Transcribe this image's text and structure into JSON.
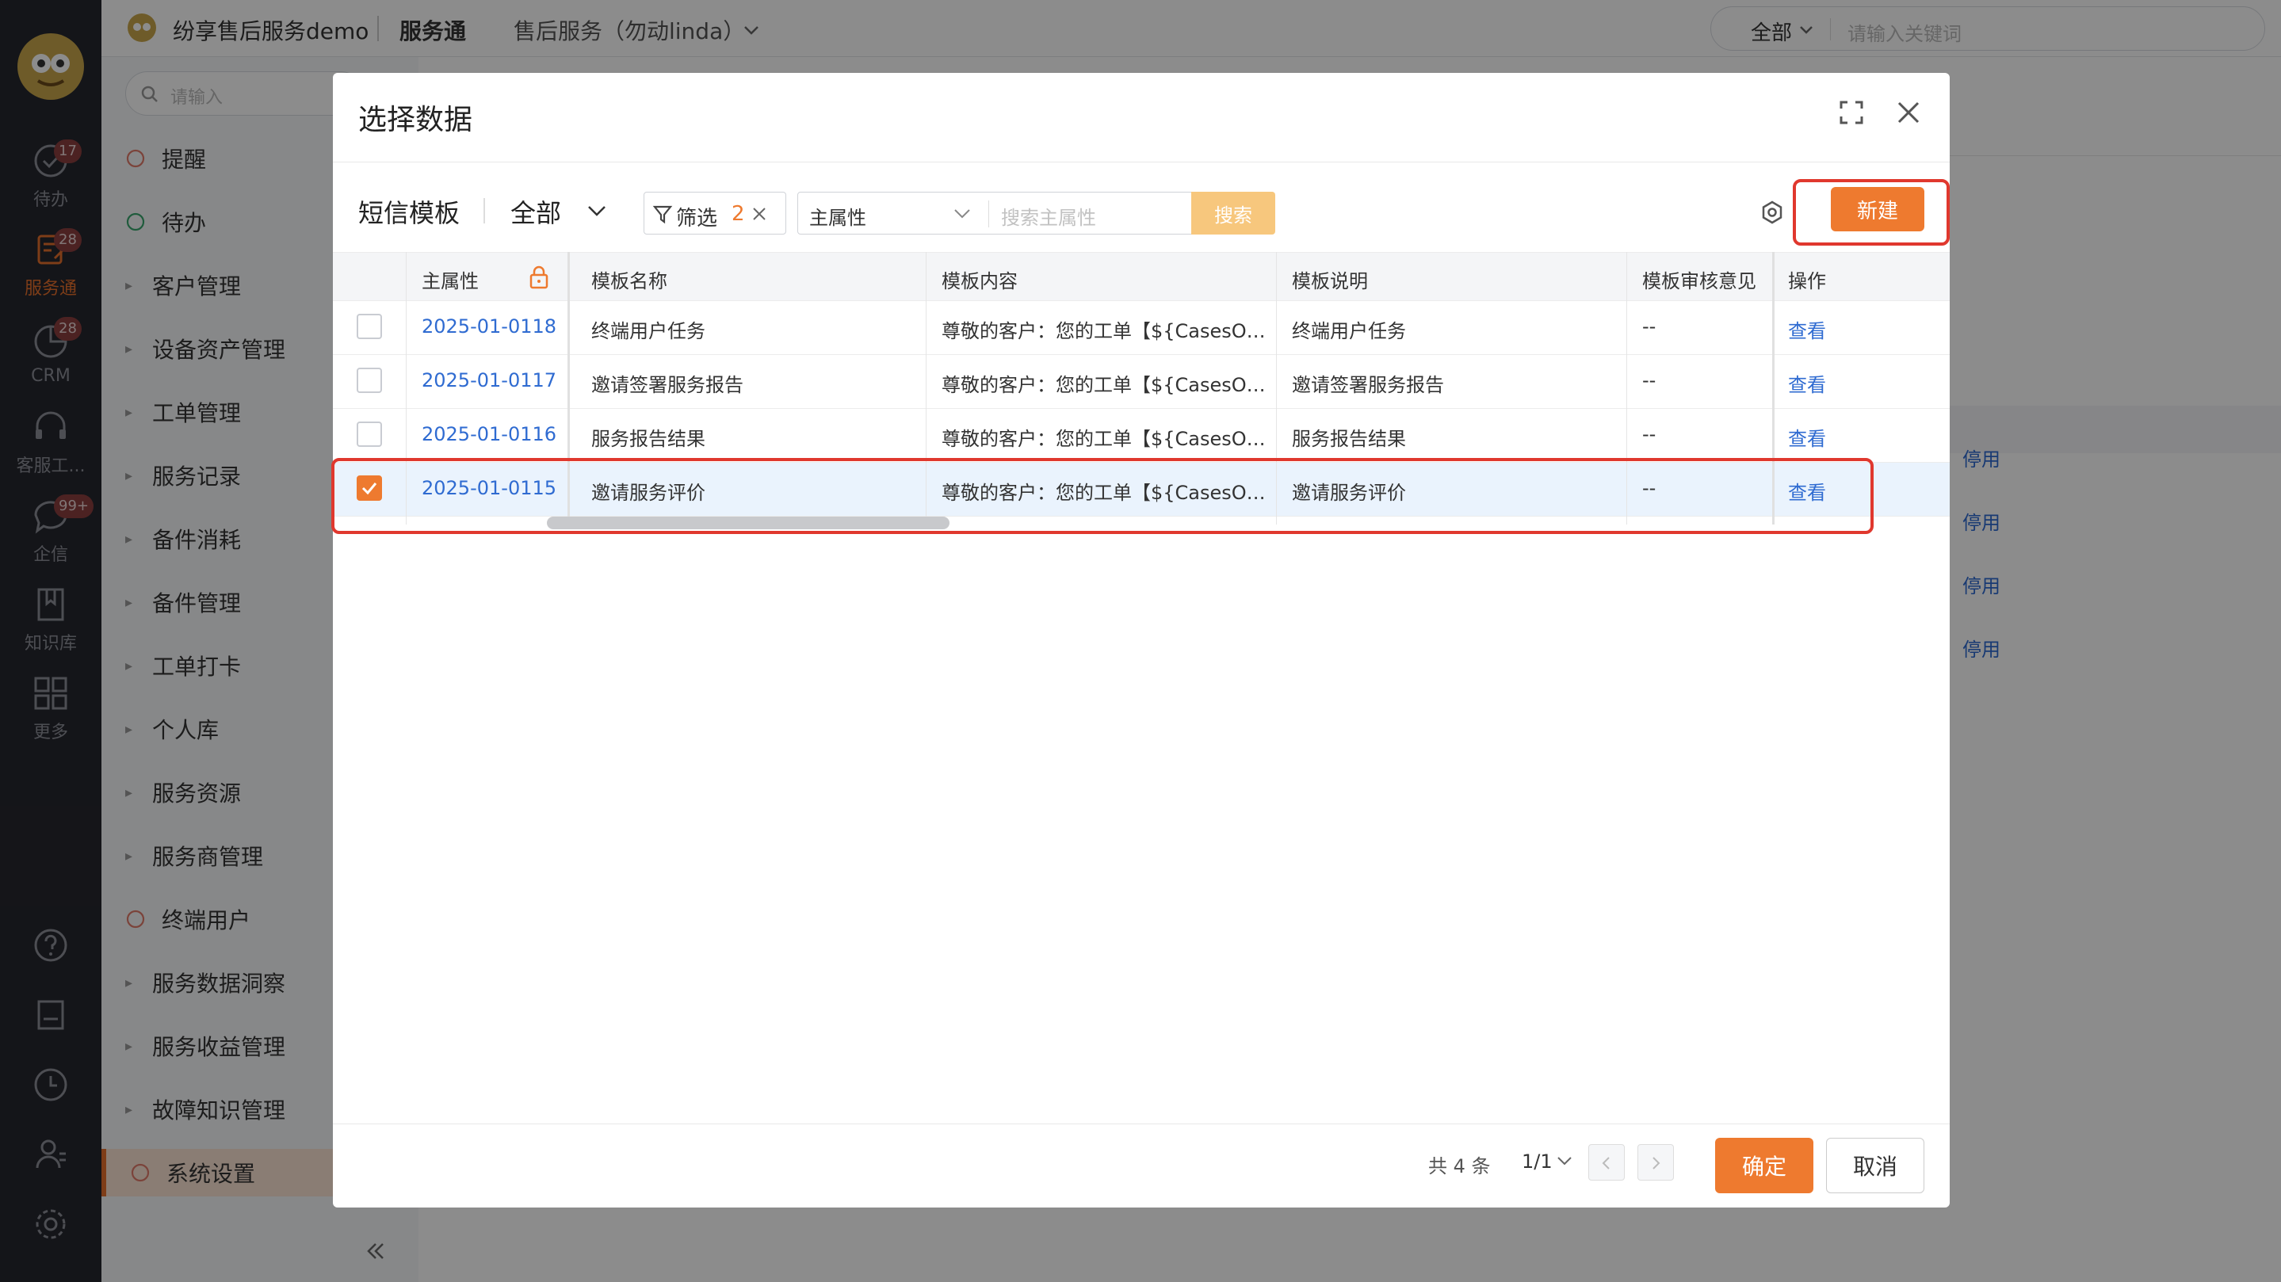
{
  "app": {
    "company": "纷享售后服务demo",
    "module": "服务通",
    "app_name": "售后服务（勿动linda）",
    "search_scope": "全部",
    "search_placeholder": "请输入关键词"
  },
  "rail": [
    {
      "icon": "todo-icon",
      "label": "待办",
      "badge": "17"
    },
    {
      "icon": "service-icon",
      "label": "服务通",
      "badge": "28"
    },
    {
      "icon": "crm-icon",
      "label": "CRM",
      "badge": "28"
    },
    {
      "icon": "headset-icon",
      "label": "客服工...",
      "badge": ""
    },
    {
      "icon": "chat-icon",
      "label": "企信",
      "badge": "99+"
    },
    {
      "icon": "book-icon",
      "label": "知识库",
      "badge": ""
    },
    {
      "icon": "grid-icon",
      "label": "更多",
      "badge": ""
    }
  ],
  "menu": {
    "search_placeholder": "请输入",
    "items": [
      {
        "label": "提醒",
        "type": "icon"
      },
      {
        "label": "待办",
        "type": "icon"
      },
      {
        "label": "客户管理",
        "type": "arrow"
      },
      {
        "label": "设备资产管理",
        "type": "arrow"
      },
      {
        "label": "工单管理",
        "type": "arrow"
      },
      {
        "label": "服务记录",
        "type": "arrow"
      },
      {
        "label": "备件消耗",
        "type": "arrow"
      },
      {
        "label": "备件管理",
        "type": "arrow"
      },
      {
        "label": "工单打卡",
        "type": "arrow"
      },
      {
        "label": "个人库",
        "type": "arrow"
      },
      {
        "label": "服务资源",
        "type": "arrow"
      },
      {
        "label": "服务商管理",
        "type": "arrow"
      },
      {
        "label": "终端用户",
        "type": "icon"
      },
      {
        "label": "服务数据洞察",
        "type": "arrow"
      },
      {
        "label": "服务收益管理",
        "type": "arrow"
      },
      {
        "label": "故障知识管理",
        "type": "arrow"
      },
      {
        "label": "系统设置",
        "type": "icon"
      }
    ]
  },
  "background": {
    "links": [
      "停用",
      "停用",
      "停用",
      "停用"
    ]
  },
  "modal": {
    "title": "选择数据",
    "object_name": "短信模板",
    "scope": "全部",
    "filter_label": "筛选",
    "filter_count": "2",
    "field_select": "主属性",
    "search_placeholder": "搜索主属性",
    "search_button": "搜索",
    "new_button": "新建",
    "columns": [
      "主属性",
      "模板名称",
      "模板内容",
      "模板说明",
      "模板审核意见",
      "操作"
    ],
    "rows": [
      {
        "id": "2025-01-0118",
        "name": "终端用户任务",
        "content": "尊敬的客户：您的工单【${CasesO…",
        "desc": "终端用户任务",
        "review": "--",
        "action": "查看",
        "checked": false
      },
      {
        "id": "2025-01-0117",
        "name": "邀请签署服务报告",
        "content": "尊敬的客户：您的工单【${CasesO…",
        "desc": "邀请签署服务报告",
        "review": "--",
        "action": "查看",
        "checked": false
      },
      {
        "id": "2025-01-0116",
        "name": "服务报告结果",
        "content": "尊敬的客户：您的工单【${CasesO…",
        "desc": "服务报告结果",
        "review": "--",
        "action": "查看",
        "checked": false
      },
      {
        "id": "2025-01-0115",
        "name": "邀请服务评价",
        "content": "尊敬的客户：您的工单【${CasesO…",
        "desc": "邀请服务评价",
        "review": "--",
        "action": "查看",
        "checked": true
      }
    ],
    "total": "共 4 条",
    "page": "1/1",
    "confirm": "确定",
    "cancel": "取消"
  },
  "colors": {
    "accent": "#ee7a2f",
    "link": "#2f6bd1",
    "highlight_box": "#e0382e"
  }
}
